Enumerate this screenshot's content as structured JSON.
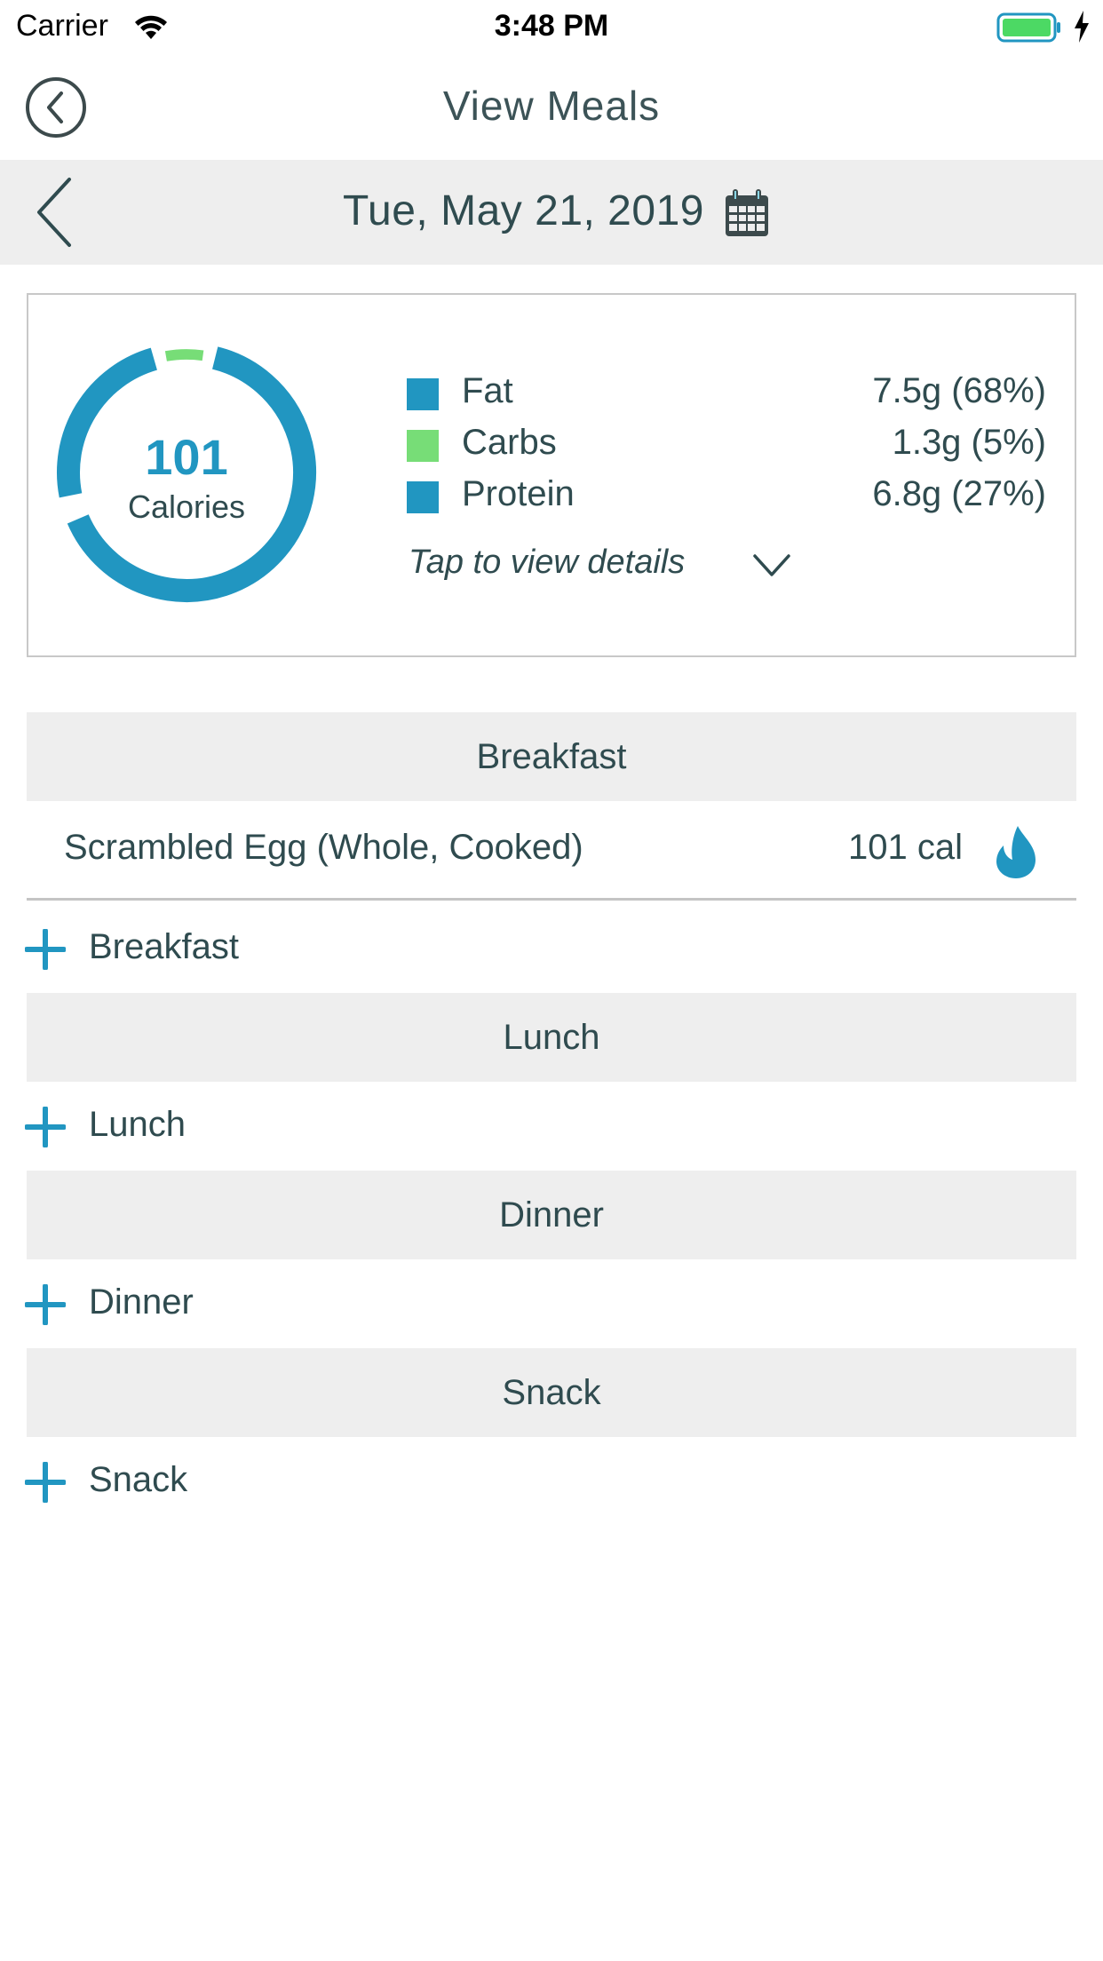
{
  "status_bar": {
    "carrier": "Carrier",
    "time": "3:48 PM",
    "wifi_icon": "wifi-icon",
    "battery_icon": "battery-charging-icon",
    "battery_color": "#4cd964"
  },
  "nav": {
    "title": "View Meals",
    "back_icon": "circle-chevron-left-icon"
  },
  "date_bar": {
    "date": "Tue, May 21, 2019",
    "prev_icon": "chevron-left-icon",
    "calendar_icon": "calendar-icon"
  },
  "summary": {
    "calories_value": "101",
    "calories_label": "Calories",
    "details_link": "Tap to view details",
    "macros": [
      {
        "name": "Fat",
        "value": "7.5g (68%)",
        "percent": 68,
        "color": "#2196c1"
      },
      {
        "name": "Carbs",
        "value": "1.3g (5%)",
        "percent": 5,
        "color": "#77dd77"
      },
      {
        "name": "Protein",
        "value": "6.8g (27%)",
        "percent": 27,
        "color": "#2196c1"
      }
    ]
  },
  "meals": [
    {
      "name": "Breakfast",
      "add_label": "Breakfast",
      "items": [
        {
          "name": "Scrambled Egg (Whole, Cooked)",
          "calories": "101 cal"
        }
      ]
    },
    {
      "name": "Lunch",
      "add_label": "Lunch",
      "items": []
    },
    {
      "name": "Dinner",
      "add_label": "Dinner",
      "items": []
    },
    {
      "name": "Snack",
      "add_label": "Snack",
      "items": []
    }
  ],
  "colors": {
    "accent": "#2196c1",
    "carbs": "#77dd77",
    "text": "#2f4b4f",
    "section_bg": "#eeeeee"
  }
}
